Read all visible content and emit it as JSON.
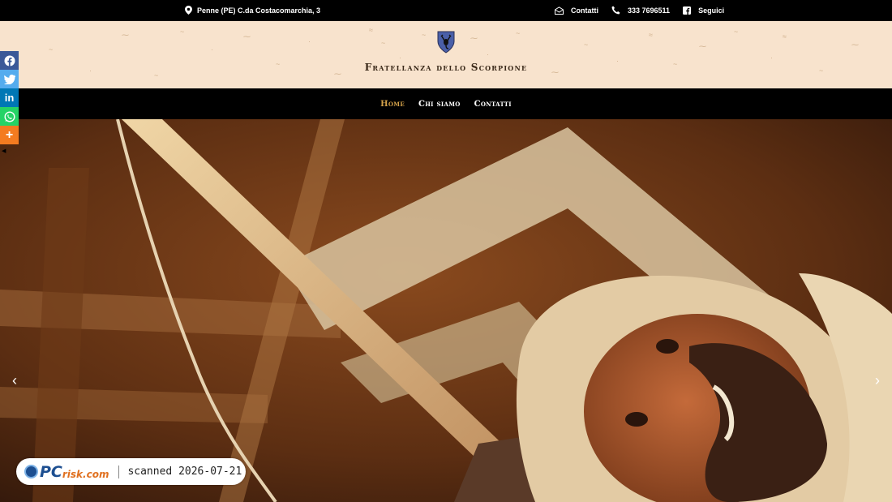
{
  "topbar": {
    "address": "Penne (PE) C.da Costacomarchia, 3",
    "contacts_label": "Contatti",
    "phone": "333 7696511",
    "follow_label": "Seguici",
    "icons": [
      "map-pin-icon",
      "envelope-icon",
      "phone-icon",
      "facebook-icon"
    ]
  },
  "header": {
    "brand": "Fratellanza dello Scorpione",
    "background": "#f8e3cd"
  },
  "nav": {
    "items": [
      {
        "label": "Home",
        "active": true
      },
      {
        "label": "Chi siamo",
        "active": false
      },
      {
        "label": "Contatti",
        "active": false
      }
    ],
    "active_color": "#d4a24a"
  },
  "hero": {
    "prev_arrow": "‹",
    "next_arrow": "›"
  },
  "share": {
    "buttons": [
      {
        "name": "facebook",
        "color": "#3b5998",
        "glyph": "f"
      },
      {
        "name": "twitter",
        "color": "#55acee",
        "glyph": "t"
      },
      {
        "name": "linkedin",
        "color": "#0077b5",
        "glyph": "in"
      },
      {
        "name": "whatsapp",
        "color": "#25d366",
        "glyph": "w"
      },
      {
        "name": "more",
        "color": "#f47b20",
        "glyph": "+"
      }
    ]
  },
  "watermark": {
    "pc": "PC",
    "risk": "risk.com",
    "scanned": "scanned 2026-07-21"
  }
}
